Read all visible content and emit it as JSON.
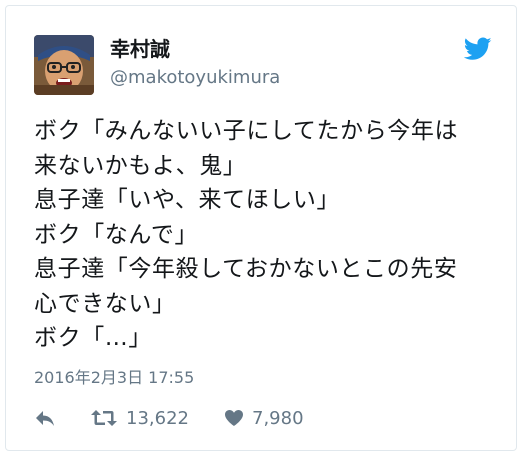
{
  "tweet": {
    "author": {
      "display_name": "幸村誠",
      "handle": "@makotoyukimura"
    },
    "text_lines": [
      "ボク「みんないい子にしてたから今年は",
      "来ないかもよ、鬼」",
      "息子達「いや、来てほしい」",
      "ボク「なんで」",
      "息子達「今年殺しておかないとこの先安",
      "心できない」",
      "ボク「…」"
    ],
    "timestamp": "2016年2月3日 17:55",
    "actions": {
      "reply_icon": "reply-icon",
      "retweet_icon": "retweet-icon",
      "retweet_count": "13,622",
      "like_icon": "heart-icon",
      "like_count": "7,980"
    }
  },
  "colors": {
    "text": "#14171a",
    "secondary": "#657786",
    "twitter_blue": "#1da1f2",
    "border": "#e1e8ed"
  }
}
